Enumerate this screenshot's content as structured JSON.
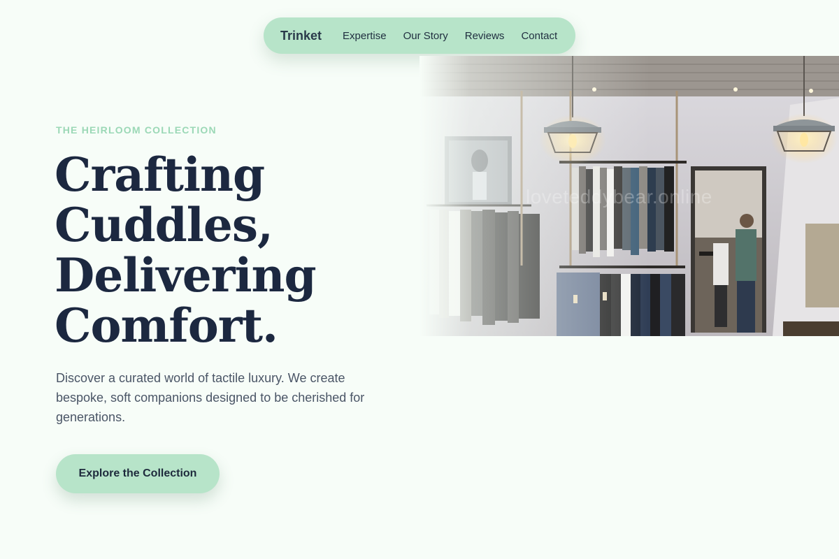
{
  "nav": {
    "brand": "Trinket",
    "links": [
      "Expertise",
      "Our Story",
      "Reviews",
      "Contact"
    ]
  },
  "hero": {
    "eyebrow": "THE HEIRLOOM COLLECTION",
    "headline": [
      "Crafting",
      "Cuddles,",
      "Delivering",
      "Comfort."
    ],
    "description": "Discover a curated world of tactile luxury. We create bespoke, soft companions designed to be cherished for generations.",
    "cta_label": "Explore the Collection",
    "image_watermark": "loveteddybear.online"
  },
  "colors": {
    "background": "#f7fdf8",
    "accent_mint": "#b7e4c9",
    "eyebrow_mint": "#9bd8b6",
    "heading_navy": "#1c2840",
    "body_text": "#4a5566"
  }
}
